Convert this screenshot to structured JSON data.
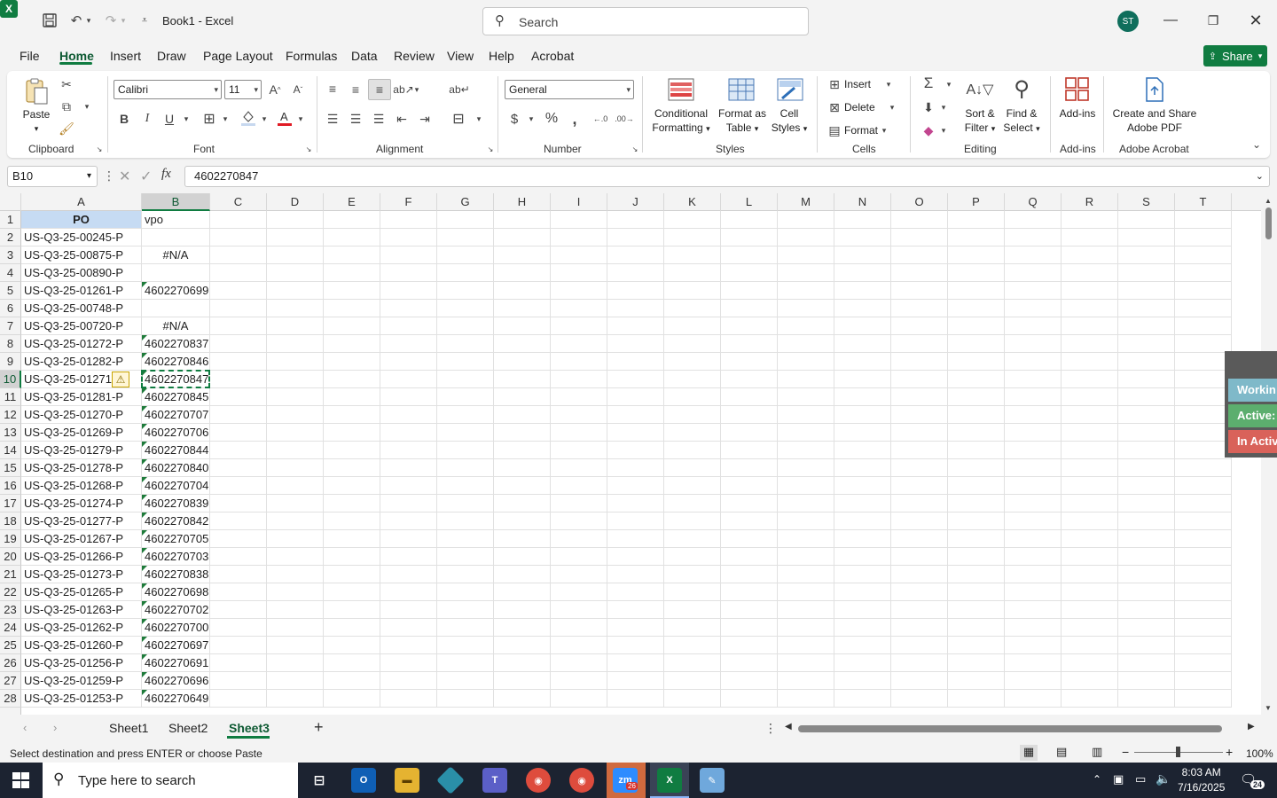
{
  "titlebar": {
    "doc_title": "Book1  -  Excel",
    "search_placeholder": "Search",
    "avatar_initials": "ST"
  },
  "menu": {
    "tabs": [
      "File",
      "Home",
      "Insert",
      "Draw",
      "Page Layout",
      "Formulas",
      "Data",
      "Review",
      "View",
      "Help",
      "Acrobat"
    ],
    "share_label": "Share"
  },
  "ribbon": {
    "clipboard": {
      "paste": "Paste",
      "label": "Clipboard"
    },
    "font": {
      "name": "Calibri",
      "size": "11",
      "label": "Font"
    },
    "alignment": {
      "label": "Alignment"
    },
    "number": {
      "format": "General",
      "label": "Number"
    },
    "styles": {
      "cond_line1": "Conditional",
      "cond_line2": "Formatting",
      "fmt_line1": "Format as",
      "fmt_line2": "Table",
      "cell_line1": "Cell",
      "cell_line2": "Styles",
      "label": "Styles"
    },
    "cells": {
      "insert": "Insert",
      "delete": "Delete",
      "format": "Format",
      "label": "Cells"
    },
    "editing": {
      "sort_line1": "Sort &",
      "sort_line2": "Filter",
      "find_line1": "Find &",
      "find_line2": "Select",
      "label": "Editing"
    },
    "addins": {
      "button": "Add-ins",
      "label": "Add-ins"
    },
    "acrobat": {
      "line1": "Create and Share",
      "line2": "Adobe PDF",
      "label": "Adobe Acrobat"
    }
  },
  "formula_bar": {
    "name_box": "B10",
    "fx": "fx",
    "value": "4602270847"
  },
  "grid": {
    "columns": [
      "A",
      "B",
      "C",
      "D",
      "E",
      "F",
      "G",
      "H",
      "I",
      "J",
      "K",
      "L",
      "M",
      "N",
      "O",
      "P",
      "Q",
      "R",
      "S",
      "T"
    ],
    "header_row": {
      "a": "PO",
      "b": "vpo"
    },
    "rows": [
      {
        "n": "2",
        "a": "US-Q3-25-00245-P",
        "b": ""
      },
      {
        "n": "3",
        "a": "US-Q3-25-00875-P",
        "b": "#N/A"
      },
      {
        "n": "4",
        "a": "US-Q3-25-00890-P",
        "b": ""
      },
      {
        "n": "5",
        "a": "US-Q3-25-01261-P",
        "b": "4602270699"
      },
      {
        "n": "6",
        "a": "US-Q3-25-00748-P",
        "b": ""
      },
      {
        "n": "7",
        "a": "US-Q3-25-00720-P",
        "b": "#N/A"
      },
      {
        "n": "8",
        "a": "US-Q3-25-01272-P",
        "b": "4602270837"
      },
      {
        "n": "9",
        "a": "US-Q3-25-01282-P",
        "b": "4602270846"
      },
      {
        "n": "10",
        "a": "US-Q3-25-01271-",
        "b": "4602270847"
      },
      {
        "n": "11",
        "a": "US-Q3-25-01281-P",
        "b": "4602270845"
      },
      {
        "n": "12",
        "a": "US-Q3-25-01270-P",
        "b": "4602270707"
      },
      {
        "n": "13",
        "a": "US-Q3-25-01269-P",
        "b": "4602270706"
      },
      {
        "n": "14",
        "a": "US-Q3-25-01279-P",
        "b": "4602270844"
      },
      {
        "n": "15",
        "a": "US-Q3-25-01278-P",
        "b": "4602270840"
      },
      {
        "n": "16",
        "a": "US-Q3-25-01268-P",
        "b": "4602270704"
      },
      {
        "n": "17",
        "a": "US-Q3-25-01274-P",
        "b": "4602270839"
      },
      {
        "n": "18",
        "a": "US-Q3-25-01277-P",
        "b": "4602270842"
      },
      {
        "n": "19",
        "a": "US-Q3-25-01267-P",
        "b": "4602270705"
      },
      {
        "n": "20",
        "a": "US-Q3-25-01266-P",
        "b": "4602270703"
      },
      {
        "n": "21",
        "a": "US-Q3-25-01273-P",
        "b": "4602270838"
      },
      {
        "n": "22",
        "a": "US-Q3-25-01265-P",
        "b": "4602270698"
      },
      {
        "n": "23",
        "a": "US-Q3-25-01263-P",
        "b": "4602270702"
      },
      {
        "n": "24",
        "a": "US-Q3-25-01262-P",
        "b": "4602270700"
      },
      {
        "n": "25",
        "a": "US-Q3-25-01260-P",
        "b": "4602270697"
      },
      {
        "n": "26",
        "a": "US-Q3-25-01256-P",
        "b": "4602270691"
      },
      {
        "n": "27",
        "a": "US-Q3-25-01259-P",
        "b": "4602270696"
      },
      {
        "n": "28",
        "a": "US-Q3-25-01253-P",
        "b": "4602270649"
      }
    ]
  },
  "float_panel": {
    "items": [
      {
        "label": "Workin",
        "color": "#7fb9c9"
      },
      {
        "label": "Active: (",
        "color": "#5cae6e"
      },
      {
        "label": "In Activ",
        "color": "#d9625a"
      }
    ]
  },
  "sheets": {
    "tabs": [
      "Sheet1",
      "Sheet2",
      "Sheet3"
    ],
    "active": "Sheet3"
  },
  "status": {
    "message": "Select destination and press ENTER or choose Paste",
    "zoom": "100%"
  },
  "taskbar": {
    "search_placeholder": "Type here to search",
    "time": "8:03 AM",
    "date": "7/16/2025",
    "notif_count": "24",
    "zoom_badge": "26"
  },
  "colors": {
    "accent": "#107c41",
    "header_a_fill": "#c6dbf3",
    "taskbar": "#1c2331"
  }
}
